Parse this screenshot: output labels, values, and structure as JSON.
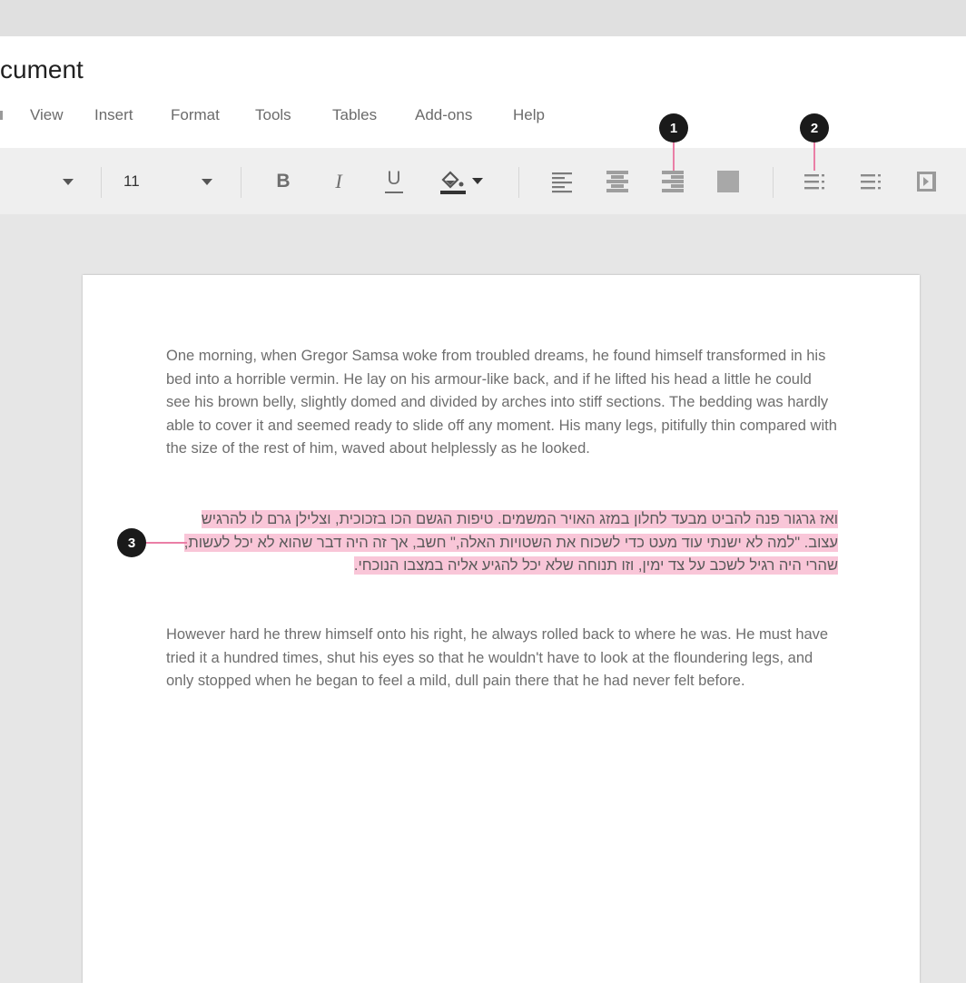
{
  "document": {
    "title": "cument"
  },
  "menu": {
    "items": [
      {
        "id": "view",
        "label": "View"
      },
      {
        "id": "insert",
        "label": "Insert"
      },
      {
        "id": "format",
        "label": "Format"
      },
      {
        "id": "tools",
        "label": "Tools"
      },
      {
        "id": "tables",
        "label": "Tables"
      },
      {
        "id": "addons",
        "label": "Add-ons"
      },
      {
        "id": "help",
        "label": "Help"
      }
    ]
  },
  "toolbar": {
    "font_size": "11",
    "bold_label": "B",
    "italic_label": "I",
    "underline_label": "U"
  },
  "content": {
    "para1": "One morning, when Gregor Samsa woke from troubled dreams, he found himself transformed in his bed into a horrible vermin. He lay on his armour-like back, and if he lifted his head a little he could see his brown belly, slightly domed and divided by arches into stiff sections. The bedding was hardly able to cover it and seemed ready to slide off any moment. His many legs, pitifully thin compared with the size of the rest of him, waved about helplessly as he looked.",
    "para2": "ואז גרגור פנה להביט מבעד לחלון במזג האויר המשמים. טיפות הגשם הכו בזכוכית, וצלילן גרם לו להרגיש עצוב. \"למה לא ישנתי עוד מעט כדי לשכוח את השטויות האלה,\" חשב, אך זה היה דבר שהוא לא יכל לעשות, שהרי היה רגיל לשכב על צד ימין, וזו תנוחה שלא יכל להגיע אליה במצבו הנוכחי.",
    "para3": "However hard he threw himself onto his right, he always rolled back to where he was. He must have tried it a hundred times, shut his eyes so that he wouldn't have to look at the floundering legs, and only stopped when he began to feel a mild, dull pain there that he had never felt before."
  },
  "callouts": [
    "1",
    "2",
    "3"
  ],
  "colors": {
    "highlight": "#f9c6d8",
    "leader": "#ea7fa6",
    "callout": "#1a1a1a"
  }
}
